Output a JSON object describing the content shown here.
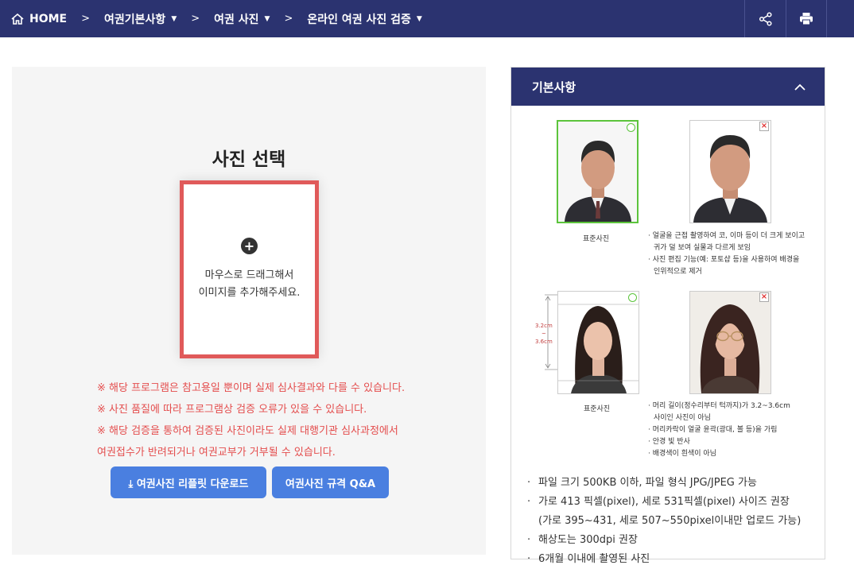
{
  "nav": {
    "home": "HOME",
    "crumb1": "여권기본사항",
    "crumb2": "여권 사진",
    "crumb3": "온라인 여권 사진 검증",
    "caret": "▼",
    "sep": ">"
  },
  "upload": {
    "title": "사진 선택",
    "plus": "+",
    "drop_line1": "마우스로 드래그해서",
    "drop_line2": "이미지를 추가해주세요."
  },
  "notes": [
    "※ 해당 프로그램은 참고용일 뿐이며 실제 심사결과와 다를 수 있습니다.",
    "※ 사진 품질에 따라 프로그램상 검증 오류가 있을 수 있습니다.",
    "※ 해당 검증을 통하여 검증된 사진이라도 실제 대행기관 심사과정에서",
    "여권접수가 반려되거나 여권교부가 거부될 수 있습니다."
  ],
  "buttons": {
    "download": "⤓ 여권사진 리플릿 다운로드",
    "qa": "여권사진 규격 Q&A"
  },
  "info": {
    "title": "기본사항",
    "standard_caption": "표준사진",
    "bad1": [
      "· 얼굴을 근접 촬영하여 코, 이마 등이 더 크게 보이고",
      "귀가 덜 보여 실물과 다르게 보임",
      "· 사진 편집 기능(예: 포토샵 등)을 사용하여 배경을",
      "인위적으로 제거"
    ],
    "bad2": [
      "· 머리 길이(정수리부터 턱까지)가 3.2~3.6cm",
      "사이인 사진이 아님",
      "· 머리카락이 얼굴 윤곽(광대, 볼 등)을 가림",
      "· 안경 빛 반사",
      "· 배경색이 흰색이 아님"
    ],
    "measure": [
      "3.2cm",
      "~",
      "3.6cm"
    ],
    "specs": [
      "파일 크기 500KB 이하, 파일 형식 JPG/JPEG 가능",
      "가로 413 픽셀(pixel), 세로 531픽셀(pixel) 사이즈 권장",
      "(가로 395~431, 세로 507~550pixel이내만 업로드 가능)",
      "해상도는 300dpi 권장",
      "6개월 이내에 촬영된 사진"
    ]
  },
  "colors": {
    "nav": "#2b3370",
    "accent": "#4a7fe0",
    "warn": "#e44d4d",
    "ok": "#5cc43c",
    "bad": "#e03030"
  }
}
